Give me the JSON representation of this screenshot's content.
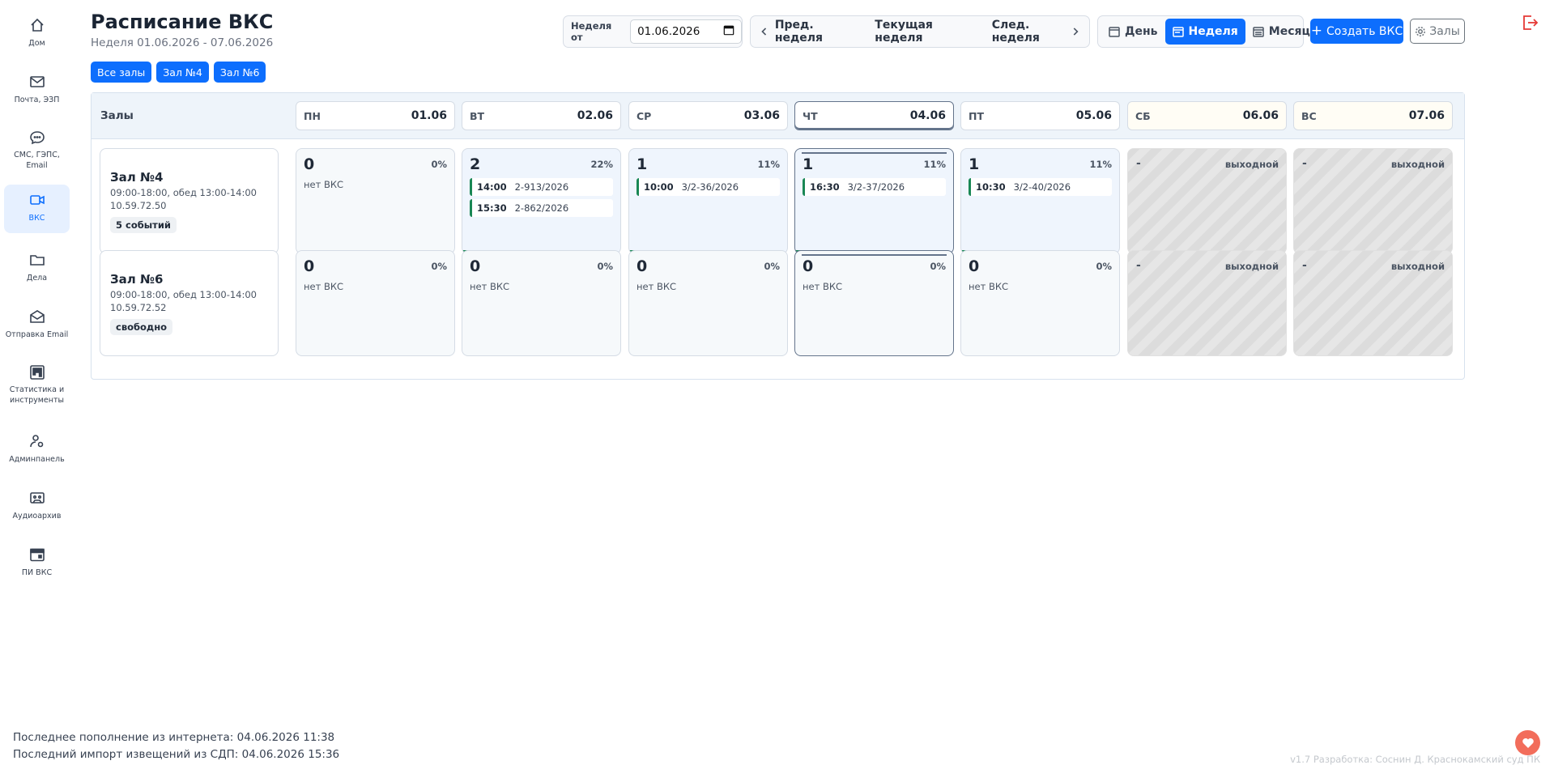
{
  "sidebar": {
    "items": [
      {
        "label": "Дом",
        "icon": "home-icon"
      },
      {
        "label": "Почта, ЭЗП",
        "icon": "mail-icon"
      },
      {
        "label": "СМС, ГЭПС, Email",
        "icon": "chat-icon"
      },
      {
        "label": "ВКС",
        "icon": "video-icon",
        "active": true
      },
      {
        "label": "Дела",
        "icon": "folder-icon"
      },
      {
        "label": "Отправка Email",
        "icon": "envelope-open-icon"
      },
      {
        "label": "Статистика и инструменты",
        "icon": "kanban-icon"
      },
      {
        "label": "Админпанель",
        "icon": "user-gear-icon"
      },
      {
        "label": "Аудиоархив",
        "icon": "cassette-icon"
      },
      {
        "label": "ПИ ВКС",
        "icon": "calendar-event-icon"
      }
    ]
  },
  "header": {
    "title": "Расписание ВКС",
    "subtitle": "Неделя 01.06.2026 - 07.06.2026",
    "week_from_label": "Неделя от",
    "week_from_value": "01.06.2026",
    "prev_week": "Пред. неделя",
    "current_week": "Текущая неделя",
    "next_week": "След. неделя",
    "view_day": "День",
    "view_week": "Неделя",
    "view_month": "Месяц",
    "create_button": "Создать ВКС",
    "halls_button": "Залы"
  },
  "filters": [
    "Все залы",
    "Зал №4",
    "Зал №6"
  ],
  "schedule": {
    "halls_label": "Залы",
    "days": [
      {
        "name": "ПН",
        "date": "01.06"
      },
      {
        "name": "ВТ",
        "date": "02.06"
      },
      {
        "name": "СР",
        "date": "03.06"
      },
      {
        "name": "ЧТ",
        "date": "04.06",
        "today": true
      },
      {
        "name": "ПТ",
        "date": "05.06"
      },
      {
        "name": "СБ",
        "date": "06.06",
        "weekend": true
      },
      {
        "name": "ВС",
        "date": "07.06",
        "weekend": true
      }
    ],
    "empty_text": "нет ВКС",
    "weekend_text": "выходной",
    "weekend_dash": "-",
    "halls": [
      {
        "name": "Зал №4",
        "hours": "09:00-18:00, обед 13:00-14:00",
        "ip": "10.59.72.50",
        "badge": "5 событий",
        "cells": [
          {
            "count": "0",
            "pct": "0%",
            "load": 0,
            "events": []
          },
          {
            "count": "2",
            "pct": "22%",
            "load": 0.22,
            "events": [
              {
                "time": "14:00",
                "case": "2-913/2026"
              },
              {
                "time": "15:30",
                "case": "2-862/2026"
              }
            ]
          },
          {
            "count": "1",
            "pct": "11%",
            "load": 0.11,
            "events": [
              {
                "time": "10:00",
                "case": "3/2-36/2026"
              }
            ]
          },
          {
            "count": "1",
            "pct": "11%",
            "load": 0.11,
            "events": [
              {
                "time": "16:30",
                "case": "3/2-37/2026"
              }
            ]
          },
          {
            "count": "1",
            "pct": "11%",
            "load": 0.11,
            "events": [
              {
                "time": "10:30",
                "case": "3/2-40/2026"
              }
            ]
          }
        ]
      },
      {
        "name": "Зал №6",
        "hours": "09:00-18:00, обед 13:00-14:00",
        "ip": "10.59.72.52",
        "badge": "свободно",
        "cells": [
          {
            "count": "0",
            "pct": "0%",
            "load": 0,
            "events": []
          },
          {
            "count": "0",
            "pct": "0%",
            "load": 0,
            "events": []
          },
          {
            "count": "0",
            "pct": "0%",
            "load": 0,
            "events": []
          },
          {
            "count": "0",
            "pct": "0%",
            "load": 0,
            "events": []
          },
          {
            "count": "0",
            "pct": "0%",
            "load": 0,
            "events": []
          }
        ]
      }
    ]
  },
  "footer": {
    "last_internet_update": "Последнее пополнение из интернета: 04.06.2026 11:38",
    "last_sdp_import": "Последний импорт извещений из СДП: 04.06.2026 15:36",
    "version": "v1.7 Разработка: Соснин Д. Краснокамский суд ПК"
  },
  "colors": {
    "accent": "#0d6efd",
    "load": "#198754",
    "logout": "#e53935",
    "heart": "#f26d5b"
  }
}
